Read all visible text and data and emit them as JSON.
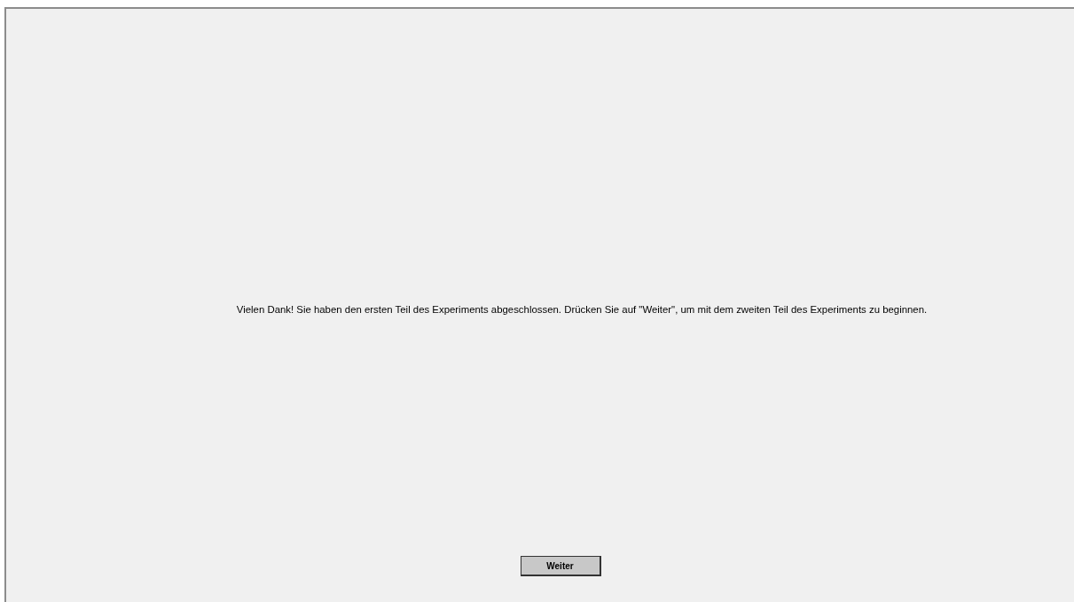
{
  "message": "Vielen Dank! Sie haben den ersten Teil des Experiments abgeschlossen. Drücken Sie auf \"Weiter\", um mit dem zweiten Teil des Experiments zu beginnen.",
  "buttons": [
    "Weiter"
  ]
}
